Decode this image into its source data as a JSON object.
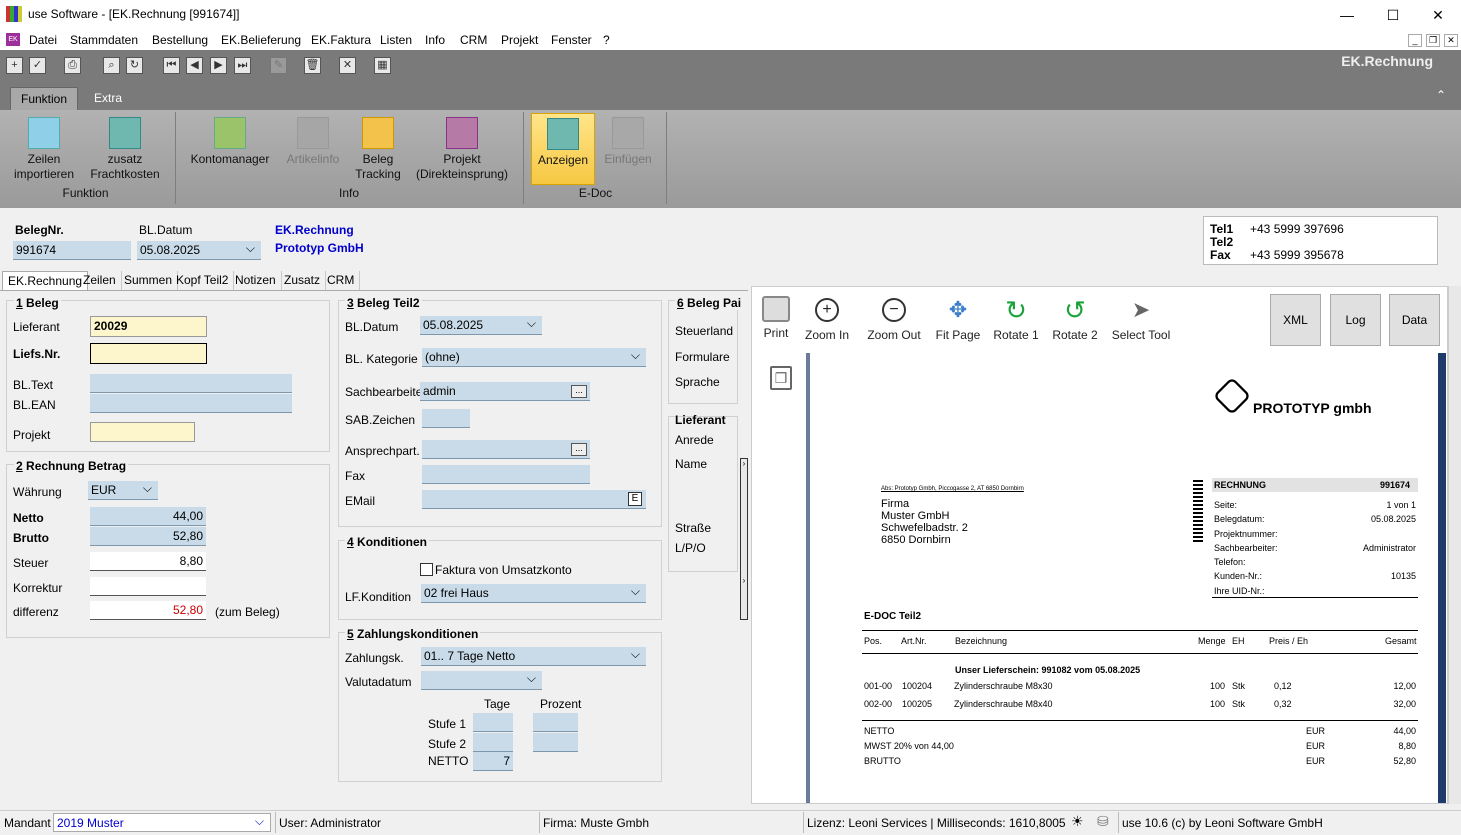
{
  "window": {
    "title": "use Software - [EK.Rechnung [991674]]",
    "minimize": "—",
    "maximize": "☐",
    "close": "✕"
  },
  "menu": [
    "Datei",
    "Stammdaten",
    "Bestellung",
    "EK.Belieferung",
    "EK.Faktura",
    "Listen",
    "Info",
    "CRM",
    "Projekt",
    "Fenster",
    "?"
  ],
  "brand": "EK.Rechnung",
  "ribbon_tabs": [
    "Funktion",
    "Extra"
  ],
  "ribbon": {
    "zeilen": "Zeilen\nimportieren",
    "fracht": "zusatz\nFrachtkosten",
    "grp_funktion": "Funktion",
    "konto": "Kontomanager",
    "artikel": "Artikelinfo",
    "beleg": "Beleg\nTracking",
    "projekt": "Projekt\n(Direkteinsprung)",
    "grp_info": "Info",
    "anzeigen": "Anzeigen",
    "einfuegen": "Einfügen",
    "grp_edoc": "E-Doc"
  },
  "header": {
    "belegnr_label": "BelegNr.",
    "belegnr": "991674",
    "bldatum_label": "BL.Datum",
    "bldatum": "05.08.2025",
    "doc_type": "EK.Rechnung",
    "company": "Prototyp GmbH",
    "tel1_label": "Tel1",
    "tel1": "+43 5999 397696",
    "tel2_label": "Tel2",
    "fax_label": "Fax",
    "fax": "+43 5999 395678"
  },
  "form_tabs": [
    "EK.Rechnung",
    "Zeilen",
    "Summen",
    "Kopf Teil2",
    "Notizen",
    "Zusatz",
    "CRM"
  ],
  "s1": {
    "title_num": "1",
    "title": " Beleg",
    "lieferant_label": "Lieferant",
    "lieferant": "20029",
    "liefsnr_label": "Liefs.Nr.",
    "bltext_label": "BL.Text",
    "blean_label": "BL.EAN",
    "projekt_label": "Projekt"
  },
  "s2": {
    "title_num": "2",
    "title": " Rechnung Betrag",
    "waehrung_label": "Währung",
    "waehrung": "EUR",
    "netto_label": "Netto",
    "netto": "44,00",
    "brutto_label": "Brutto",
    "brutto": "52,80",
    "steuer_label": "Steuer",
    "steuer": "8,80",
    "korrektur_label": "Korrektur",
    "differenz_label": "differenz",
    "differenz": "52,80",
    "zum_beleg": "(zum Beleg)"
  },
  "s3": {
    "title_num": "3",
    "title": " Beleg Teil2",
    "bldatum_label": "BL.Datum",
    "bldatum": "05.08.2025",
    "kategorie_label": "BL. Kategorie",
    "kategorie": "(ohne)",
    "sachbearbeiter_label": "Sachbearbeiter",
    "sachbearbeiter": "admin",
    "sab_label": "SAB.Zeichen",
    "ansprech_label": "Ansprechpart.",
    "fax_label": "Fax",
    "email_label": "EMail",
    "ebtn": "E"
  },
  "s4": {
    "title_num": "4",
    "title": " Konditionen",
    "faktura_label": "Faktura von Umsatzkonto",
    "lfkond_label": "LF.Kondition",
    "lfkond": "02 frei Haus"
  },
  "s5": {
    "title_num": "5",
    "title": " Zahlungskonditionen",
    "zahlungsk_label": "Zahlungsk.",
    "zahlungsk": "01.. 7 Tage Netto",
    "valuta_label": "Valutadatum",
    "tage_label": "Tage",
    "prozent_label": "Prozent",
    "stufe1_label": "Stufe 1",
    "stufe2_label": "Stufe 2",
    "netto_label": "NETTO",
    "netto_tage": "7"
  },
  "s6": {
    "title_num": "6",
    "title": " Beleg Pai",
    "steuerland": "Steuerland",
    "formulare": "Formulare",
    "sprache": "Sprache",
    "lieferant": "Lieferant",
    "anrede": "Anrede",
    "name": "Name",
    "strasse": "Straße",
    "lpo": "L/P/O"
  },
  "viewer": {
    "print": "Print",
    "zoomin": "Zoom In",
    "zoomout": "Zoom Out",
    "fitpage": "Fit Page",
    "rotate1": "Rotate 1",
    "rotate2": "Rotate 2",
    "select": "Select Tool",
    "xml": "XML",
    "log": "Log",
    "data": "Data"
  },
  "doc": {
    "logo": "PROTOTYP gmbh",
    "sender": "Abs: Prototyp Gmbh, Piccogasse 2, AT 6850 Dornbirn",
    "addr": [
      "Firma",
      "Muster GmbH",
      "Schwefelbadstr. 2",
      "6850 Dornbirn"
    ],
    "rech_label": "RECHNUNG",
    "rech_nr": "991674",
    "info": [
      [
        "Seite:",
        "1 von 1"
      ],
      [
        "Belegdatum:",
        "05.08.2025"
      ],
      [
        "Projektnummer:",
        ""
      ],
      [
        "Sachbearbeiter:",
        "Administrator"
      ],
      [
        "Telefon:",
        ""
      ],
      [
        "Kunden-Nr.:",
        "10135"
      ],
      [
        "Ihre UID-Nr.:",
        ""
      ]
    ],
    "edoc": "E-DOC Teil2",
    "cols": [
      "Pos.",
      "Art.Nr.",
      "Bezeichnung",
      "Menge",
      "EH",
      "Preis / Eh",
      "Gesamt"
    ],
    "ls": "Unser Lieferschein: 991082 vom 05.08.2025",
    "rows": [
      [
        "001-00",
        "100204",
        "Zylinderschraube M8x30",
        "100",
        "Stk",
        "0,12",
        "12,00"
      ],
      [
        "002-00",
        "100205",
        "Zylinderschraube M8x40",
        "100",
        "Stk",
        "0,32",
        "32,00"
      ]
    ],
    "totals": [
      [
        "NETTO",
        "EUR",
        "44,00"
      ],
      [
        "MWST 20% von 44,00",
        "EUR",
        "8,80"
      ],
      [
        "BRUTTO",
        "EUR",
        "52,80"
      ]
    ]
  },
  "status": {
    "mandant_label": "Mandant",
    "mandant": "2019 Muster",
    "user": "User: Administrator",
    "firma": "Firma: Muste Gmbh",
    "lizenz": "Lizenz: Leoni Services | Milliseconds: 1610,8005",
    "version": "use 10.6 (c) by Leoni Software GmbH"
  },
  "colors": {
    "accent_blue": "#0000cc",
    "field_blue": "#c9dbe8",
    "field_yellow": "#fdf5cc",
    "red": "#cc0000",
    "anzeigen": "#f6c842"
  }
}
